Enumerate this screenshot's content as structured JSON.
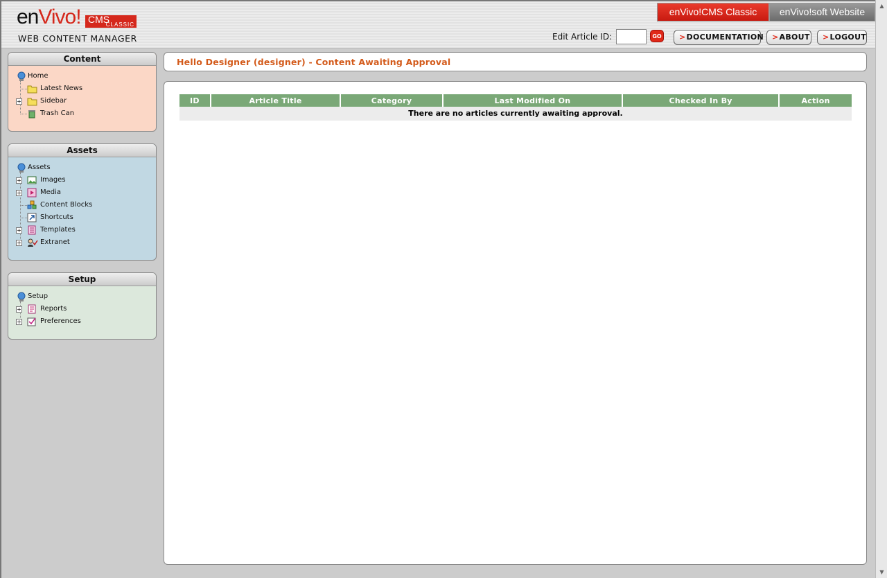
{
  "header": {
    "logo_brand_en": "en",
    "logo_brand_vivo": "Vivo!",
    "logo_cms": "CMS",
    "logo_classic": "CLASSIC",
    "tagline": "WEB CONTENT MANAGER",
    "site_tabs": [
      "enVivo!CMS Classic",
      "enVivo!soft Website"
    ],
    "edit_id_label": "Edit Article ID:",
    "edit_id_value": "",
    "go_label": "GO",
    "nav": [
      {
        "arrow": ">",
        "label": "DOCUMENTATION"
      },
      {
        "arrow": ">",
        "label": "ABOUT"
      },
      {
        "arrow": ">",
        "label": "LOGOUT"
      }
    ]
  },
  "sidebar": {
    "content": {
      "title": "Content",
      "items": [
        {
          "label": "Home",
          "icon": "globe-icon",
          "level": "root"
        },
        {
          "label": "Latest News",
          "icon": "folder-icon",
          "level": "child"
        },
        {
          "label": "Sidebar",
          "icon": "folder-icon",
          "level": "child",
          "expander": "+"
        },
        {
          "label": "Trash Can",
          "icon": "trash-icon",
          "level": "child"
        }
      ]
    },
    "assets": {
      "title": "Assets",
      "items": [
        {
          "label": "Assets",
          "icon": "globe-icon",
          "level": "root"
        },
        {
          "label": "Images",
          "icon": "image-icon",
          "level": "child",
          "expander": "+"
        },
        {
          "label": "Media",
          "icon": "media-icon",
          "level": "child",
          "expander": "+"
        },
        {
          "label": "Content Blocks",
          "icon": "blocks-icon",
          "level": "child"
        },
        {
          "label": "Shortcuts",
          "icon": "shortcut-icon",
          "level": "child"
        },
        {
          "label": "Templates",
          "icon": "template-icon",
          "level": "child",
          "expander": "+"
        },
        {
          "label": "Extranet",
          "icon": "users-icon",
          "level": "child",
          "expander": "+"
        }
      ]
    },
    "setup": {
      "title": "Setup",
      "items": [
        {
          "label": "Setup",
          "icon": "globe-icon",
          "level": "root"
        },
        {
          "label": "Reports",
          "icon": "report-icon",
          "level": "child",
          "expander": "+"
        },
        {
          "label": "Preferences",
          "icon": "checkbox-icon",
          "level": "child",
          "expander": "+"
        }
      ]
    }
  },
  "main": {
    "greeting": "Hello Designer (designer) - Content Awaiting Approval",
    "table": {
      "columns": [
        "ID",
        "Article Title",
        "Category",
        "Last Modified On",
        "Checked In By",
        "Action"
      ],
      "empty_message": "There are no articles currently awaiting approval."
    }
  },
  "colors": {
    "accent_red": "#d5281c",
    "table_header": "#7aa877",
    "greeting_text": "#d35a1a",
    "content_panel": "#fbd7c6",
    "assets_panel": "#c1d8e3",
    "setup_panel": "#dce8dc"
  }
}
